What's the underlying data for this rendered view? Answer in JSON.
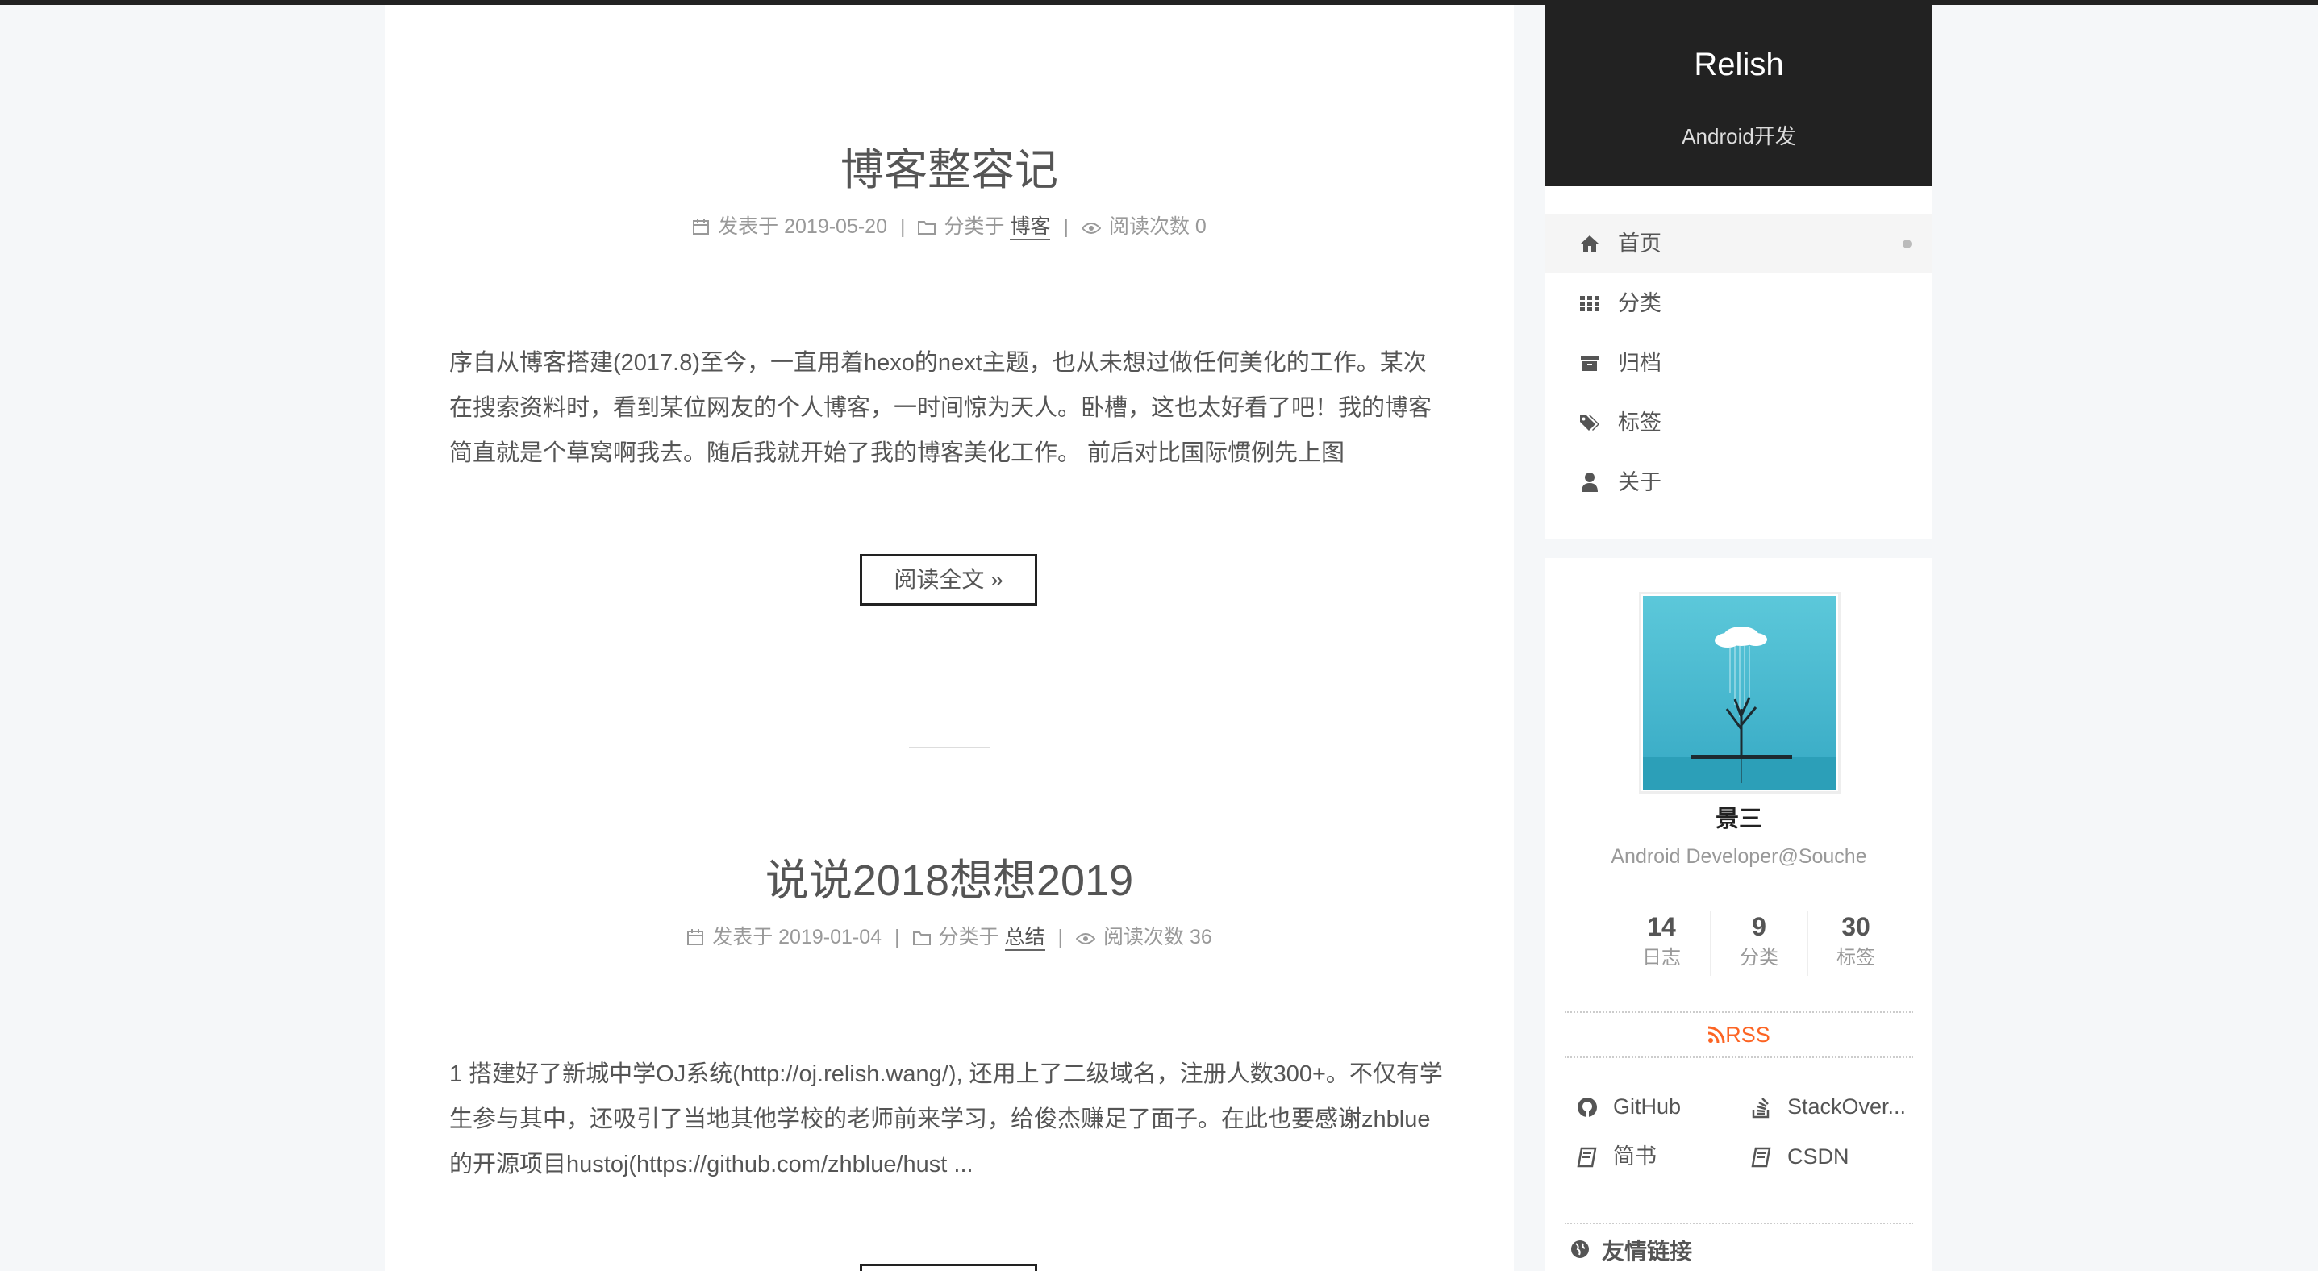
{
  "site": {
    "title": "Relish",
    "subtitle": "Android开发"
  },
  "menu": [
    {
      "label": "首页",
      "icon": "home-icon",
      "active": true
    },
    {
      "label": "分类",
      "icon": "grid-icon",
      "active": false
    },
    {
      "label": "归档",
      "icon": "archive-icon",
      "active": false
    },
    {
      "label": "标签",
      "icon": "tags-icon",
      "active": false
    },
    {
      "label": "关于",
      "icon": "user-icon",
      "active": false
    }
  ],
  "posts": [
    {
      "title": "博客整容记",
      "date_label": "发表于 2019-05-20",
      "category_prefix": "分类于",
      "category": "博客",
      "views_label": "阅读次数 0",
      "excerpt": "序自从博客搭建(2017.8)至今，一直用着hexo的next主题，也从未想过做任何美化的工作。某次在搜索资料时，看到某位网友的个人博客，一时间惊为天人。卧槽，这也太好看了吧！我的博客简直就是个草窝啊我去。随后我就开始了我的博客美化工作。 前后对比国际惯例先上图",
      "read_more": "阅读全文 »"
    },
    {
      "title": "说说2018想想2019",
      "date_label": "发表于 2019-01-04",
      "category_prefix": "分类于",
      "category": "总结",
      "views_label": "阅读次数 36",
      "excerpt": "1 搭建好了新城中学OJ系统(http://oj.relish.wang/), 还用上了二级域名，注册人数300+。不仅有学生参与其中，还吸引了当地其他学校的老师前来学习，给俊杰赚足了面子。在此也要感谢zhblue的开源项目hustoj(https://github.com/zhblue/hust ..."
    }
  ],
  "profile": {
    "name": "景三",
    "description": "Android Developer@Souche",
    "stats": [
      {
        "count": "14",
        "label": "日志"
      },
      {
        "count": "9",
        "label": "分类"
      },
      {
        "count": "30",
        "label": "标签"
      }
    ],
    "rss": "RSS",
    "links": [
      {
        "label": "GitHub",
        "icon": "github-icon"
      },
      {
        "label": "StackOver...",
        "icon": "stackoverflow-icon"
      },
      {
        "label": "简书",
        "icon": "book-icon"
      },
      {
        "label": "CSDN",
        "icon": "book-icon"
      }
    ],
    "friends_title": "友情链接"
  },
  "colors": {
    "accent_rss": "#fc6423",
    "brand_bg": "#222222",
    "page_bg": "#f5f7f9"
  }
}
